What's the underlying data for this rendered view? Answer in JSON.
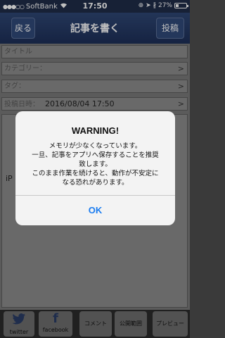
{
  "status_bar": {
    "signal": "●●●○○",
    "carrier": "SoftBank",
    "wifi_icon": "wifi-icon",
    "time": "17:50",
    "icons": "⊕ ➤ ∦",
    "battery_percent": "27%",
    "battery_level": 0.27
  },
  "nav": {
    "back_label": "戻る",
    "title": "記事を書く",
    "post_label": "投稿"
  },
  "form": {
    "title_placeholder": "タイトル",
    "category_label": "カテゴリー：",
    "tag_label": "タグ：",
    "post_date_label": "投稿日時：",
    "post_date_value": "2016/08/04 17:50",
    "chevron": ">",
    "body_partial_text": "iP"
  },
  "toolbar": {
    "twitter_label": "twitter",
    "facebook_label": "facebook",
    "comment_label": "コメント",
    "visibility_label": "公開範囲",
    "preview_label": "プレビュー"
  },
  "alert": {
    "title": "WARNING!",
    "message_lines": [
      "メモリが少なくなっています。",
      "一旦、記事をアプリへ保存することを推奨",
      "致します。",
      "このまま作業を続けると、動作が不安定に",
      "なる恐れがあります。"
    ],
    "ok_label": "OK"
  }
}
